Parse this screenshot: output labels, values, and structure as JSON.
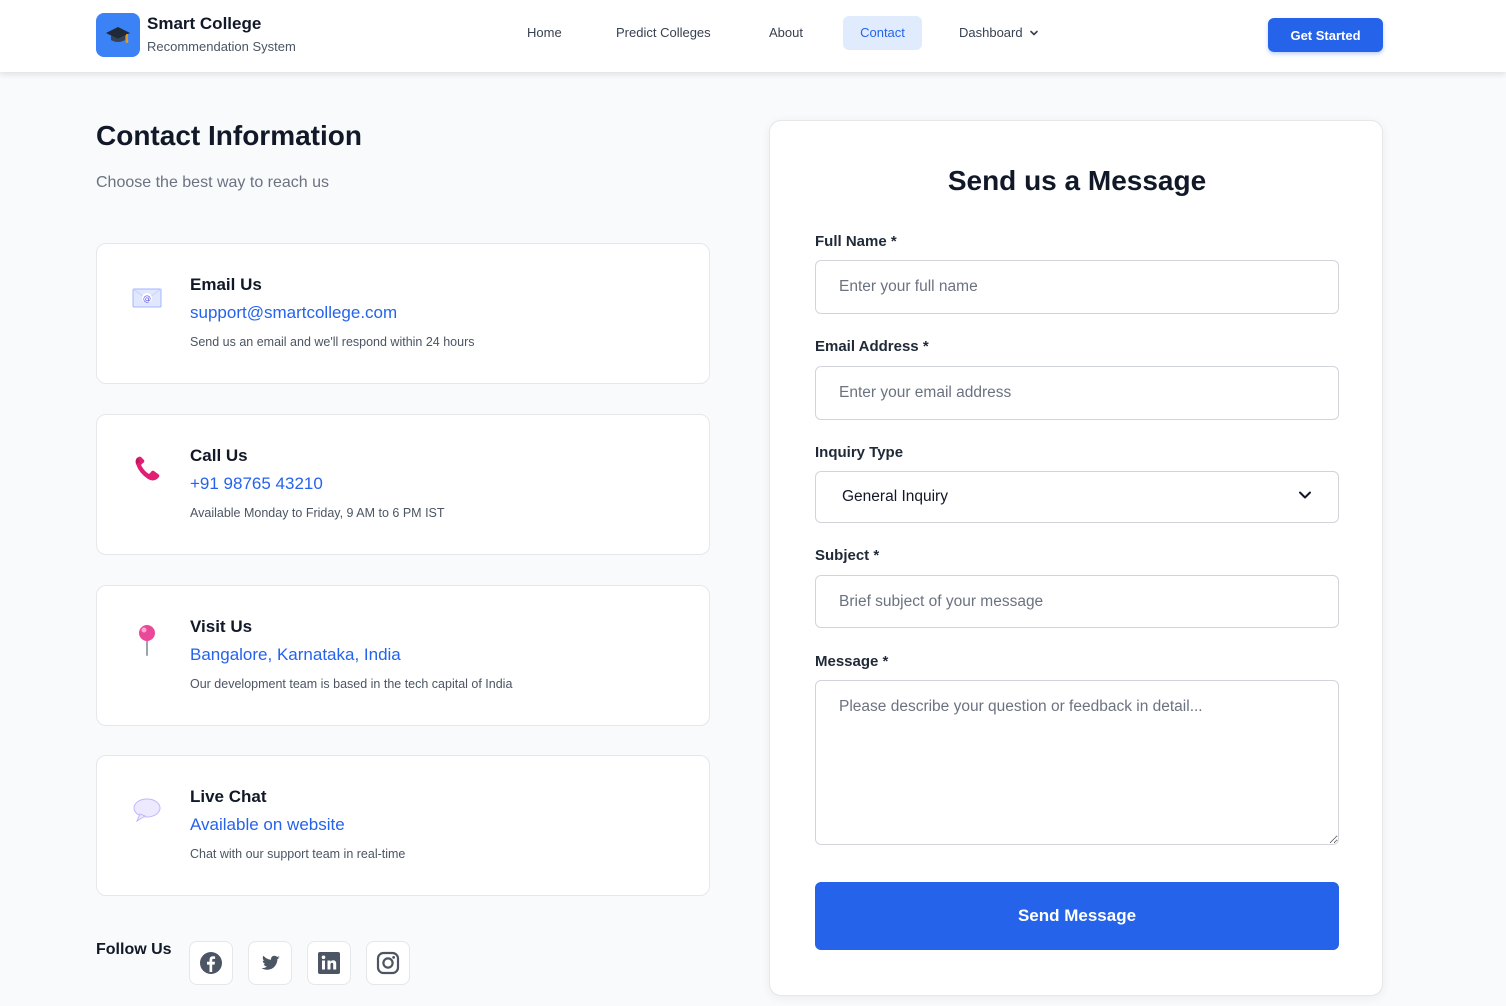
{
  "brand": {
    "title": "Smart College",
    "subtitle": "Recommendation System"
  },
  "nav": {
    "home": "Home",
    "predict": "Predict Colleges",
    "about": "About",
    "contact": "Contact",
    "dashboard": "Dashboard",
    "active": "Contact",
    "get_started": "Get Started"
  },
  "contact_info": {
    "title": "Contact Information",
    "subtitle": "Choose the best way to reach us",
    "cards": [
      {
        "icon": "email-icon",
        "title": "Email Us",
        "value": "support@smartcollege.com",
        "desc": "Send us an email and we'll respond within 24 hours"
      },
      {
        "icon": "phone-icon",
        "title": "Call Us",
        "value": "+91 98765 43210",
        "desc": "Available Monday to Friday, 9 AM to 6 PM IST"
      },
      {
        "icon": "map-pin-icon",
        "title": "Visit Us",
        "value": "Bangalore, Karnataka, India",
        "desc": "Our development team is based in the tech capital of India"
      },
      {
        "icon": "chat-bubble-icon",
        "title": "Live Chat",
        "value": "Available on website",
        "desc": "Chat with our support team in real-time"
      }
    ]
  },
  "follow": {
    "label": "Follow Us",
    "icons": [
      "facebook-icon",
      "twitter-icon",
      "linkedin-icon",
      "instagram-icon"
    ]
  },
  "form": {
    "title": "Send us a Message",
    "full_name": {
      "label": "Full Name *",
      "placeholder": "Enter your full name"
    },
    "email": {
      "label": "Email Address *",
      "placeholder": "Enter your email address"
    },
    "inquiry": {
      "label": "Inquiry Type",
      "selected": "General Inquiry"
    },
    "subject": {
      "label": "Subject *",
      "placeholder": "Brief subject of your message"
    },
    "message": {
      "label": "Message *",
      "placeholder": "Please describe your question or feedback in detail..."
    },
    "submit": "Send Message"
  },
  "colors": {
    "accent": "#2563eb",
    "background": "#f8fafc",
    "card_border": "#e5e7eb"
  }
}
